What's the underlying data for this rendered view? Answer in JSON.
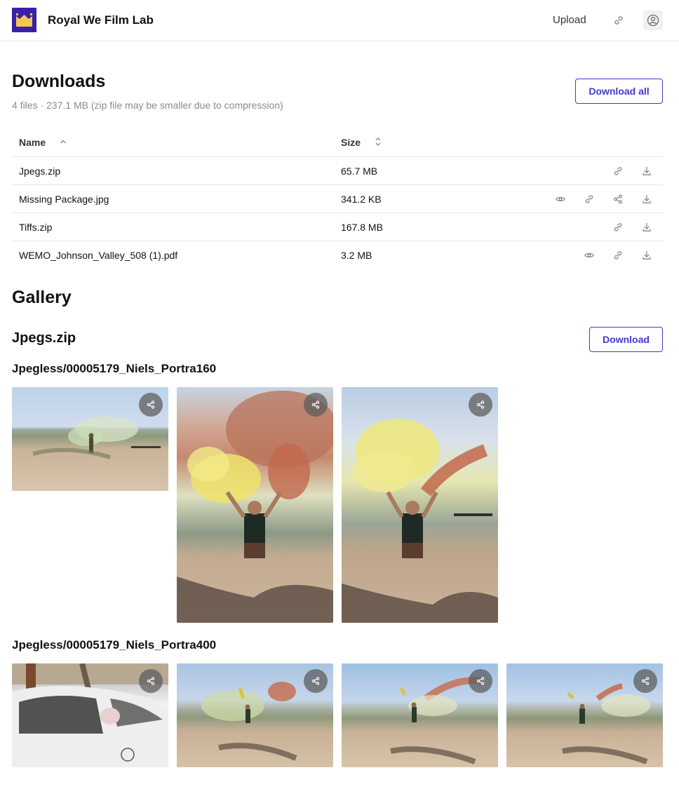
{
  "header": {
    "brand": "Royal We Film Lab",
    "upload_label": "Upload",
    "link_icon": "link-icon",
    "user_icon": "user-icon"
  },
  "downloads": {
    "title": "Downloads",
    "summary": "4 files · 237.1 MB (zip file may be smaller due to compression)",
    "download_all_label": "Download all",
    "columns": {
      "name": "Name",
      "size": "Size"
    },
    "rows": [
      {
        "name": "Jpegs.zip",
        "size": "65.7 MB",
        "actions": [
          "link-icon",
          "download-icon"
        ]
      },
      {
        "name": "Missing Package.jpg",
        "size": "341.2 KB",
        "actions": [
          "eye-icon",
          "link-icon",
          "share-icon",
          "download-icon"
        ]
      },
      {
        "name": "Tiffs.zip",
        "size": "167.8 MB",
        "actions": [
          "link-icon",
          "download-icon"
        ]
      },
      {
        "name": "WEMO_Johnson_Valley_508 (1).pdf",
        "size": "3.2 MB",
        "actions": [
          "eye-icon",
          "link-icon",
          "download-icon"
        ]
      }
    ]
  },
  "gallery": {
    "title": "Gallery",
    "archive": {
      "name": "Jpegs.zip",
      "download_label": "Download"
    },
    "folders": [
      {
        "name": "Jpegless/00005179_Niels_Portra160",
        "photos": 3
      },
      {
        "name": "Jpegless/00005179_Niels_Portra400",
        "photos": 4
      }
    ]
  },
  "colors": {
    "accent": "#4338ca",
    "logo_bg": "#3b1fa8",
    "logo_crown": "#f2c94c",
    "border": "#e5e7eb",
    "muted_text": "#8a8a8a"
  }
}
